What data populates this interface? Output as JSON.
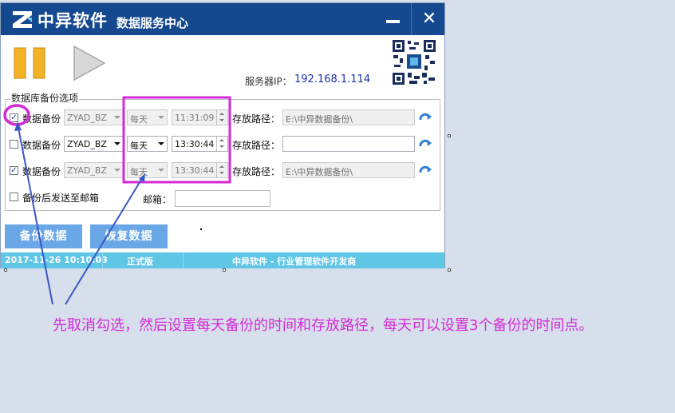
{
  "window": {
    "brand": "中异软件",
    "subtitle": "数据服务中心",
    "close_glyph": "✕"
  },
  "server": {
    "label": "服务器IP：",
    "ip": "192.168.1.114"
  },
  "group": {
    "title": "数据库备份选项",
    "rows": [
      {
        "checked": true,
        "check_glyph": "✓",
        "label": "数据备份",
        "database": "ZYAD_BZ",
        "frequency": "每天",
        "time": "11:31:09",
        "path_label": "存放路径：",
        "path": "E:\\中异数据备份\\",
        "enabled": false
      },
      {
        "checked": false,
        "check_glyph": "",
        "label": "数据备份",
        "database": "ZYAD_BZ",
        "frequency": "每天",
        "time": "13:30:44",
        "path_label": "存放路径：",
        "path": "",
        "enabled": true
      },
      {
        "checked": true,
        "check_glyph": "✓",
        "label": "数据备份",
        "database": "ZYAD_BZ",
        "frequency": "每天",
        "time": "13:30:44",
        "path_label": "存放路径：",
        "path": "E:\\中异数据备份\\",
        "enabled": false
      }
    ],
    "email_option": "备份后发送至邮箱",
    "email_label": "邮箱：",
    "email_value": ""
  },
  "buttons": {
    "backup": "备份数据",
    "restore": "恢复数据"
  },
  "status": {
    "datetime": "2017-11-26 10:10:03",
    "edition": "正式版",
    "company": "中异软件 - 行业管理软件开发商"
  },
  "annotation": {
    "text": "先取消勾选，然后设置每天备份的时间和存放路径，每天可以设置3个备份的时间点。",
    "color": "#d42ad6"
  },
  "colors": {
    "titlebar": "#14498f",
    "button": "#6aa7e6",
    "statusbar": "#5fc6e6",
    "highlight": "#d42ad6",
    "arrow": "#3a57c6"
  }
}
